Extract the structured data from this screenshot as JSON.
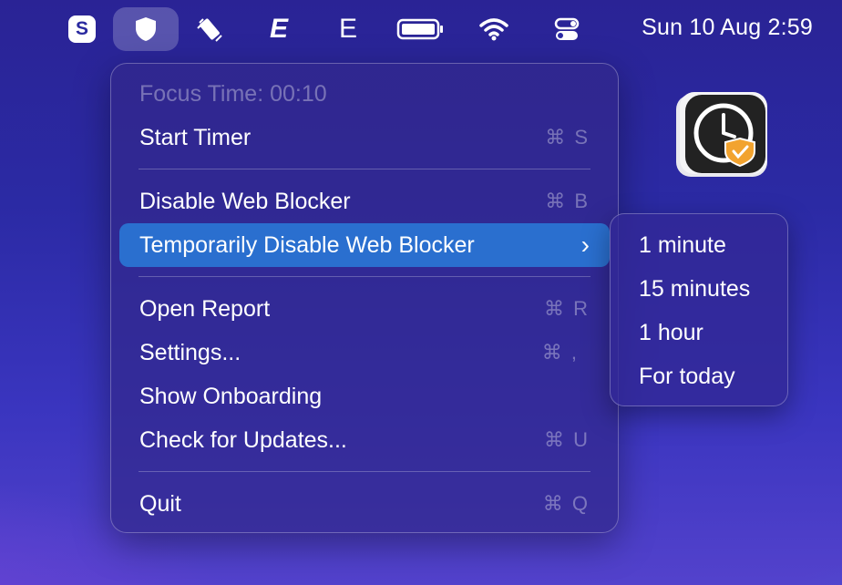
{
  "menubar": {
    "icons": [
      "skype-icon",
      "focus-shield-icon",
      "screen-rotate-icon",
      "bold-e-icon",
      "e-icon",
      "battery-icon",
      "wifi-icon",
      "control-center-icon"
    ],
    "e_letter": "E",
    "s_letter": "S",
    "clock": "Sun 10 Aug  2:59"
  },
  "menu": {
    "focus_time": "Focus Time: 00:10",
    "start_timer": {
      "label": "Start Timer",
      "shortcut": "⌘ S"
    },
    "disable_blocker": {
      "label": "Disable Web Blocker",
      "shortcut": "⌘ B"
    },
    "temp_disable": {
      "label": "Temporarily Disable Web Blocker",
      "chevron": "›"
    },
    "open_report": {
      "label": "Open Report",
      "shortcut": "⌘ R"
    },
    "settings": {
      "label": "Settings...",
      "shortcut": "⌘ ,"
    },
    "show_onboarding": {
      "label": "Show Onboarding"
    },
    "check_updates": {
      "label": "Check for Updates...",
      "shortcut": "⌘ U"
    },
    "quit": {
      "label": "Quit",
      "shortcut": "⌘ Q"
    }
  },
  "submenu": {
    "items": [
      "1 minute",
      "15 minutes",
      "1 hour",
      "For today"
    ]
  },
  "colors": {
    "highlight": "#2a6fcf",
    "desktop_top": "#2a2395",
    "desktop_bottom": "#5342cc"
  }
}
